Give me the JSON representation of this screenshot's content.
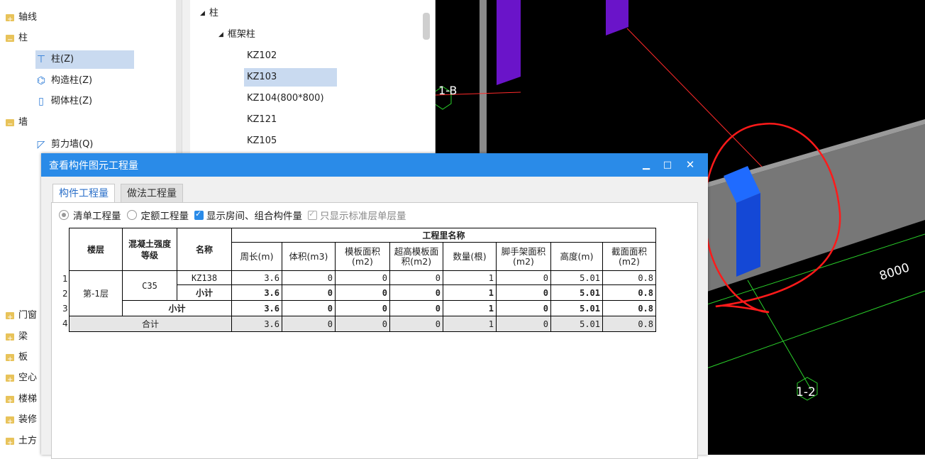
{
  "left_tree": {
    "items": [
      {
        "label": "轴线",
        "type": "folder-closed"
      },
      {
        "label": "柱",
        "type": "folder-open"
      },
      {
        "label": "柱(Z)",
        "type": "sub",
        "icon": "column-icon",
        "selected": true
      },
      {
        "label": "构造柱(Z)",
        "type": "sub",
        "icon": "construction-column-icon"
      },
      {
        "label": "砌体柱(Z)",
        "type": "sub",
        "icon": "masonry-column-icon"
      },
      {
        "label": "墙",
        "type": "folder-open"
      },
      {
        "label": "剪力墙(Q)",
        "type": "sub",
        "icon": "shear-wall-icon"
      },
      {
        "label": "门窗",
        "type": "folder-closed"
      },
      {
        "label": "梁",
        "type": "folder-closed"
      },
      {
        "label": "板",
        "type": "folder-closed"
      },
      {
        "label": "空心",
        "type": "folder-closed"
      },
      {
        "label": "楼梯",
        "type": "folder-closed"
      },
      {
        "label": "装修",
        "type": "folder-closed"
      },
      {
        "label": "土方",
        "type": "folder-closed"
      }
    ]
  },
  "component_list": {
    "root": "柱",
    "group": "框架柱",
    "items": [
      {
        "label": "KZ102"
      },
      {
        "label": "KZ103",
        "selected": true
      },
      {
        "label": "KZ104(800*800)"
      },
      {
        "label": "KZ121"
      },
      {
        "label": "KZ105"
      }
    ]
  },
  "viewport": {
    "labels": {
      "axis_b": "1-B",
      "axis_2": "1-2",
      "dimension": "8000"
    }
  },
  "dialog": {
    "title": "查看构件图元工程量",
    "tabs": [
      "构件工程量",
      "做法工程量"
    ],
    "options": {
      "radio1": "清单工程量",
      "radio2": "定额工程量",
      "check1": "显示房间、组合构件量",
      "check2": "只显示标准层单层量"
    },
    "table": {
      "group_header": "工程里名称",
      "col_floor": "楼层",
      "col_grade": "混凝土强度等级",
      "col_name": "名称",
      "metric_headers": [
        "周长(m)",
        "体积(m3)",
        "模板面积(m2)",
        "超高模板面积(m2)",
        "数量(根)",
        "脚手架面积(m2)",
        "高度(m)",
        "截面面积(m2)"
      ],
      "floor": "第-1层",
      "grade": "C35",
      "name": "KZ138",
      "subtotal_label": "小计",
      "total_label": "合计",
      "row_numbers": [
        "1",
        "2",
        "3",
        "4"
      ],
      "values": [
        "3.6",
        "0",
        "0",
        "0",
        "1",
        "0",
        "5.01",
        "0.8"
      ]
    }
  }
}
